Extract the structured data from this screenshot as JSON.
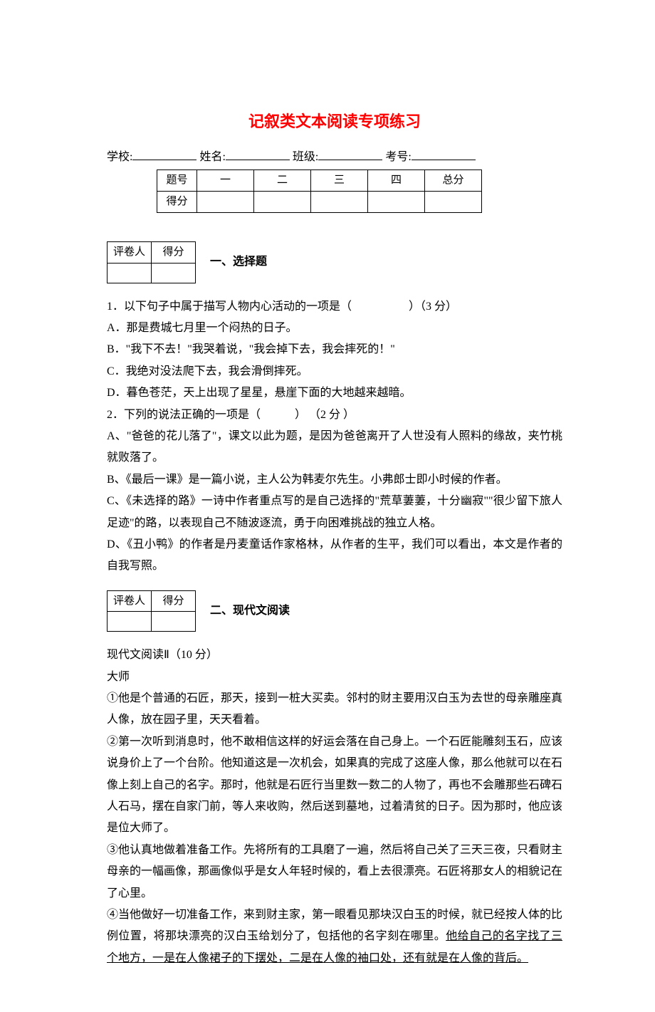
{
  "title": "记叙类文本阅读专项练习",
  "info": {
    "school_label": "学校:",
    "name_label": "姓名:",
    "class_label": "班级:",
    "examno_label": "考号:"
  },
  "score_table": {
    "row_labels": [
      "题号",
      "得分"
    ],
    "cols": [
      "一",
      "二",
      "三",
      "四",
      "总分"
    ]
  },
  "grader": {
    "c1": "评卷人",
    "c2": "得分"
  },
  "section1": {
    "label": "一、选择题",
    "q1": {
      "stem": "1．以下句子中属于描写人物内心活动的一项是（　　　　　）（3 分）",
      "A": "A．那是费城七月里一个闷热的日子。",
      "B": "B．\"我下不去！\"我哭着说，\"我会掉下去，我会摔死的！\"",
      "C": "C．我绝对没法爬下去，我会滑倒摔死。",
      "D": "D．暮色苍茫，天上出现了星星，悬崖下面的大地越来越暗。"
    },
    "q2": {
      "stem": "2．下列的说法正确的一项是（　　　） （2 分 ）",
      "A": "A、\"爸爸的花儿落了\"，课文以此为题，是因为爸爸离开了人世没有人照料的缘故，夹竹桃就败落了。",
      "B": "B、《最后一课》是一篇小说，主人公为韩麦尔先生。小弗郎士即小时候的作者。",
      "C": "C、《未选择的路》一诗中作者重点写的是自己选择的\"荒草萋萋，十分幽寂\"\"很少留下旅人足迹\"的路，以表现自己不随波逐流，勇于向困难挑战的独立人格。",
      "D": "D、《丑小鸭》的作者是丹麦童话作家格林，从作者的生平，我们可以看出，本文是作者的自我写照。"
    }
  },
  "section2": {
    "label": "二、现代文阅读",
    "intro": "现代文阅读Ⅱ（10 分）",
    "title": "大师",
    "p1": "①他是个普通的石匠，那天，接到一桩大买卖。邻村的财主要用汉白玉为去世的母亲雕座真人像，放在园子里，天天看着。",
    "p2": "②第一次听到消息时，他不敢相信这样的好运会落在自己身上。一个石匠能雕刻玉石，应该说身价上了一个台阶。他知道这是一次机会，如果真的完成了这座人像，那么他就可以在石像上刻上自己的名字。那时，他就是石匠行当里数一数二的人物了，再也不会雕那些石碑石人石马，摆在自家门前，等人来收购，然后送到墓地，过着清贫的日子。因为那时，他应该是位大师了。",
    "p3": "③他认真地做着准备工作。先将所有的工具磨了一遍，然后将自己关了三天三夜，只看财主母亲的一幅画像，那画像似乎是女人年轻时候的，看上去很漂亮。石匠将那女人的相貌记在了心里。",
    "p4a": "④当他做好一切准备工作，来到财主家，第一眼看见那块汉白玉的时候，就已经按人体的比例位置，将那块漂亮的汉白玉给划分了，包括他的名字刻在哪里。",
    "p4b": "他给自己的名字找了三个地方，一是在人像裙子的下摆处，二是在人像的袖口处，还有就是在人像的背后。"
  }
}
